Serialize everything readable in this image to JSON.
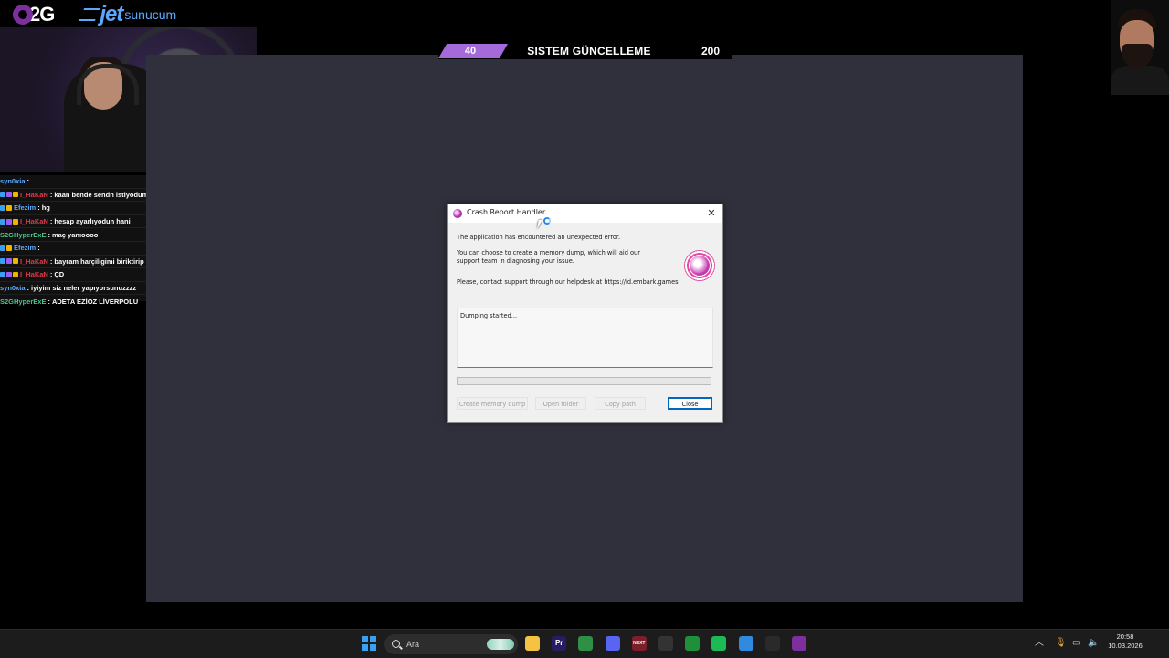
{
  "overlay": {
    "logo_left": "2G",
    "logo_right_main": "jet",
    "logo_right_sub": "sunucum"
  },
  "chat": [
    {
      "user": "syn0xia",
      "color": "#5aa9ff",
      "message": "",
      "badges": []
    },
    {
      "user": "I_HaKaN",
      "color": "#e23a4a",
      "message": "kaan bende sendn istiyodum ya",
      "badges": [
        "#3aa0f3",
        "#9c5cf0",
        "#f0b400"
      ]
    },
    {
      "user": "Efezim",
      "color": "#5aa9ff",
      "message": "hg",
      "badges": [
        "#3aa0f3",
        "#f0b400"
      ]
    },
    {
      "user": "I_HaKaN",
      "color": "#e23a4a",
      "message": "hesap ayarlıyodun hani",
      "badges": [
        "#3aa0f3",
        "#9c5cf0",
        "#f0b400"
      ]
    },
    {
      "user": "S2GHyperExE",
      "color": "#4ec48a",
      "message": "maç yanıoooo",
      "badges": []
    },
    {
      "user": "Efezim",
      "color": "#5aa9ff",
      "message": "",
      "badges": [
        "#3aa0f3",
        "#f0b400"
      ]
    },
    {
      "user": "I_HaKaN",
      "color": "#e23a4a",
      "message": "bayram harçiligimi biriktirip hesap alcam",
      "badges": [
        "#3aa0f3",
        "#9c5cf0",
        "#f0b400"
      ]
    },
    {
      "user": "I_HaKaN",
      "color": "#e23a4a",
      "message": "ÇD",
      "badges": [
        "#3aa0f3",
        "#9c5cf0",
        "#f0b400"
      ]
    },
    {
      "user": "syn0xia",
      "color": "#5aa9ff",
      "message": "iyiyim siz neler yapıyorsunuzzzz",
      "badges": []
    },
    {
      "user": "S2GHyperExE",
      "color": "#4ec48a",
      "message": "ADETA EZİOZ LİVERPOLU",
      "badges": []
    }
  ],
  "banner": {
    "left_number": "40",
    "title": "SISTEM GÜNCELLEME",
    "right_number": "200",
    "accent": "#a56ad9"
  },
  "dialog": {
    "title": "Crash Report Handler",
    "close_glyph": "✕",
    "message_error": "The application has encountered an unexpected error.",
    "message_dump": "You can choose to create a memory dump, which will aid our support team in diagnosing your issue.",
    "message_support": "Please, contact support through our helpdesk at https://id.embark.games",
    "log_text": "Dumping started...",
    "progress": 0,
    "buttons": {
      "create_dump": "Create memory dump",
      "open_folder": "Open folder",
      "copy_path": "Copy path",
      "close": "Close"
    }
  },
  "taskbar": {
    "search_placeholder": "Ara",
    "time": "20:58",
    "date": "10.03.2026",
    "apps": [
      {
        "name": "file-explorer",
        "color": "#f5c242",
        "label": ""
      },
      {
        "name": "premiere",
        "color": "#2a1c63",
        "label": "Pr"
      },
      {
        "name": "chrome",
        "color": "#2f8f46",
        "label": ""
      },
      {
        "name": "discord",
        "color": "#5865f2",
        "label": ""
      },
      {
        "name": "next",
        "color": "#7d1f2a",
        "label": "NEXT"
      },
      {
        "name": "steam-clock",
        "color": "#333333",
        "label": ""
      },
      {
        "name": "play",
        "color": "#1e8f3a",
        "label": ""
      },
      {
        "name": "spotify",
        "color": "#1db954",
        "label": ""
      },
      {
        "name": "browser-blue",
        "color": "#2f8ae0",
        "label": ""
      },
      {
        "name": "pen",
        "color": "#2a2a2a",
        "label": ""
      },
      {
        "name": "game-app",
        "color": "#7e2f9e",
        "label": ""
      }
    ]
  }
}
